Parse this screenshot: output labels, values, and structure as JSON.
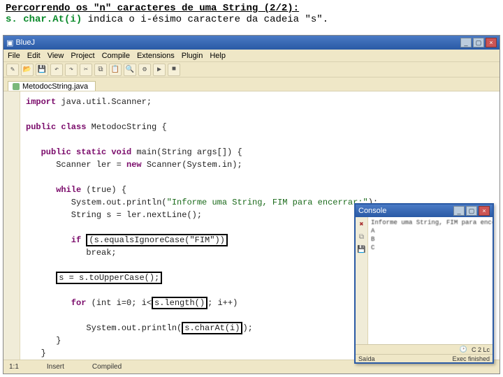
{
  "header": {
    "title": "Percorrendo os \"n\" caracteres de uma String (2/2):",
    "sub_emp": "s. char.At(i)",
    "sub_rest": " indica o i-ésimo caractere da cadeia \"s\"."
  },
  "ide": {
    "title": "BlueJ",
    "menu": [
      "File",
      "Edit",
      "View",
      "Project",
      "Compile",
      "Extensions",
      "Plugin",
      "Help"
    ],
    "tab": "MetodocString.java",
    "status": {
      "left": "1:1",
      "mid": "Insert",
      "right": "Compiled"
    }
  },
  "code": {
    "l1_a": "import",
    "l1_b": " java.util.Scanner;",
    "l2_a": "public class",
    "l2_b": " MetodocString {",
    "l3_a": "   public static void",
    "l3_b": " main(String args[]) {",
    "l4": "      Scanner ler = ",
    "l4_a": "new",
    "l4_b": " Scanner(System.in);",
    "l5_a": "      while",
    "l5_b": " (true) {",
    "l6": "         System.out.println(",
    "l6_s": "\"Informe uma String, FIM para encerrar:\"",
    "l6_e": ");",
    "l7": "         String s = ler.nextLine();",
    "l8_a": "         if",
    "l8_box": "(s.equalsIgnoreCase(\"FIM\"))",
    "l9": "            break;",
    "l10_box": "s = s.toUpperCase();",
    "l11_a": "         for",
    "l11_b": " (int i=0; i<",
    "l11_box": "s.length()",
    "l11_c": "; i++)",
    "l12_a": "            System.out.println(",
    "l12_box": "s.charAt(i)",
    "l12_b": ");",
    "l13": "      }",
    "l14": "   }",
    "l15": "}"
  },
  "console": {
    "title": "Console",
    "out": "Informe uma String, FIM para encerrar:\nA\nB\nC\n\n",
    "status_left": "Saída",
    "status_right1": "C  2  Lc",
    "status_right2": "Exec finished"
  }
}
